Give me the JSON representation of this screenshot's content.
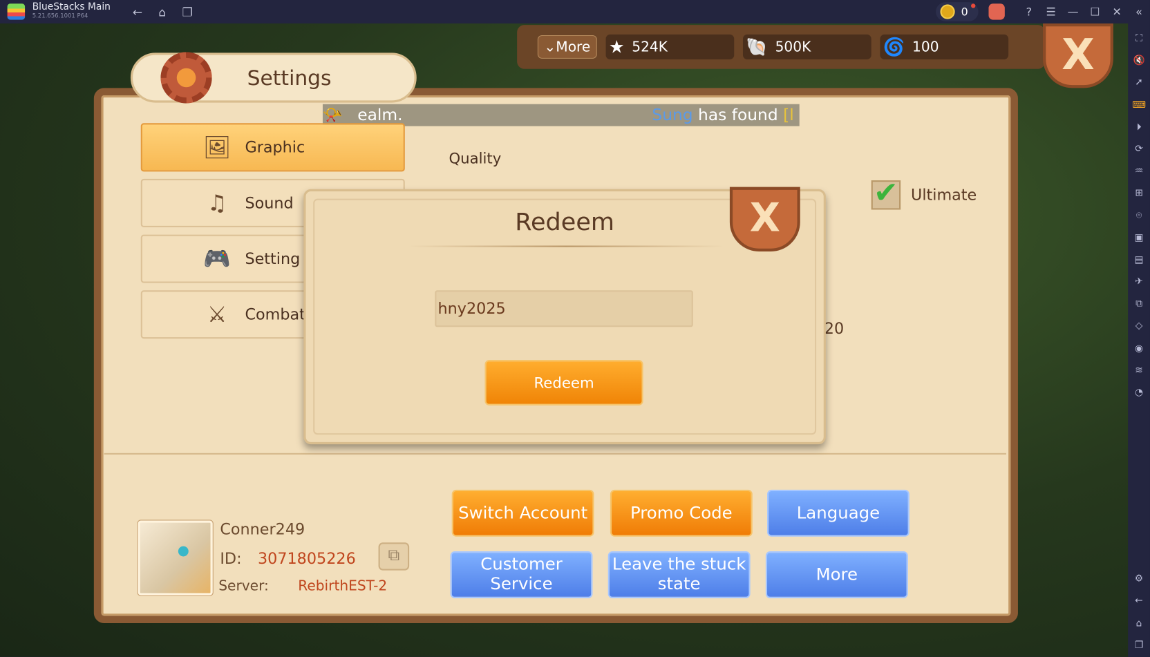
{
  "titlebar": {
    "app": "BlueStacks Main",
    "version": "5.21.656.1001  P64",
    "coins": "0"
  },
  "sidebar_icons": [
    "fullscreen-icon",
    "volume-mute-icon",
    "pointer-icon",
    "keyboard-icon",
    "record-icon",
    "rotate-sync-icon",
    "performance-icon",
    "apk-icon",
    "screenshot-icon",
    "screen-record-icon",
    "media-folder-icon",
    "airplane-icon",
    "multi-instance-icon",
    "rotate-icon",
    "location-icon",
    "layers-icon",
    "eco-mode-icon",
    "settings-icon",
    "back-icon",
    "home-icon",
    "recent-apps-icon"
  ],
  "resources": {
    "more_label": "More",
    "stars": "524K",
    "shells": "500K",
    "conch": "100"
  },
  "settings": {
    "title": "Settings",
    "tabs": [
      {
        "label": "Graphic",
        "icon": "image-icon"
      },
      {
        "label": "Sound",
        "icon": "music-icon"
      },
      {
        "label": "Setting",
        "icon": "gamepad-icon"
      },
      {
        "label": "Combat",
        "icon": "swords-icon"
      }
    ],
    "quality_label": "Quality",
    "ultimate_label": "Ultimate",
    "partial_value": "20"
  },
  "chat": {
    "prefix": "ealm.",
    "name": "Sung",
    "text": " has found ",
    "item": "[l"
  },
  "redeem": {
    "title": "Redeem",
    "code_value": "hny2025",
    "button": "Redeem"
  },
  "profile": {
    "name": "Conner249",
    "id_label": "ID:",
    "id": "3071805226",
    "server_label": "Server:",
    "server": "RebirthEST-2"
  },
  "buttons": {
    "switch": "Switch Account",
    "promo": "Promo Code",
    "language": "Language",
    "support": "Customer Service",
    "stuck": "Leave the stuck state",
    "more": "More"
  }
}
